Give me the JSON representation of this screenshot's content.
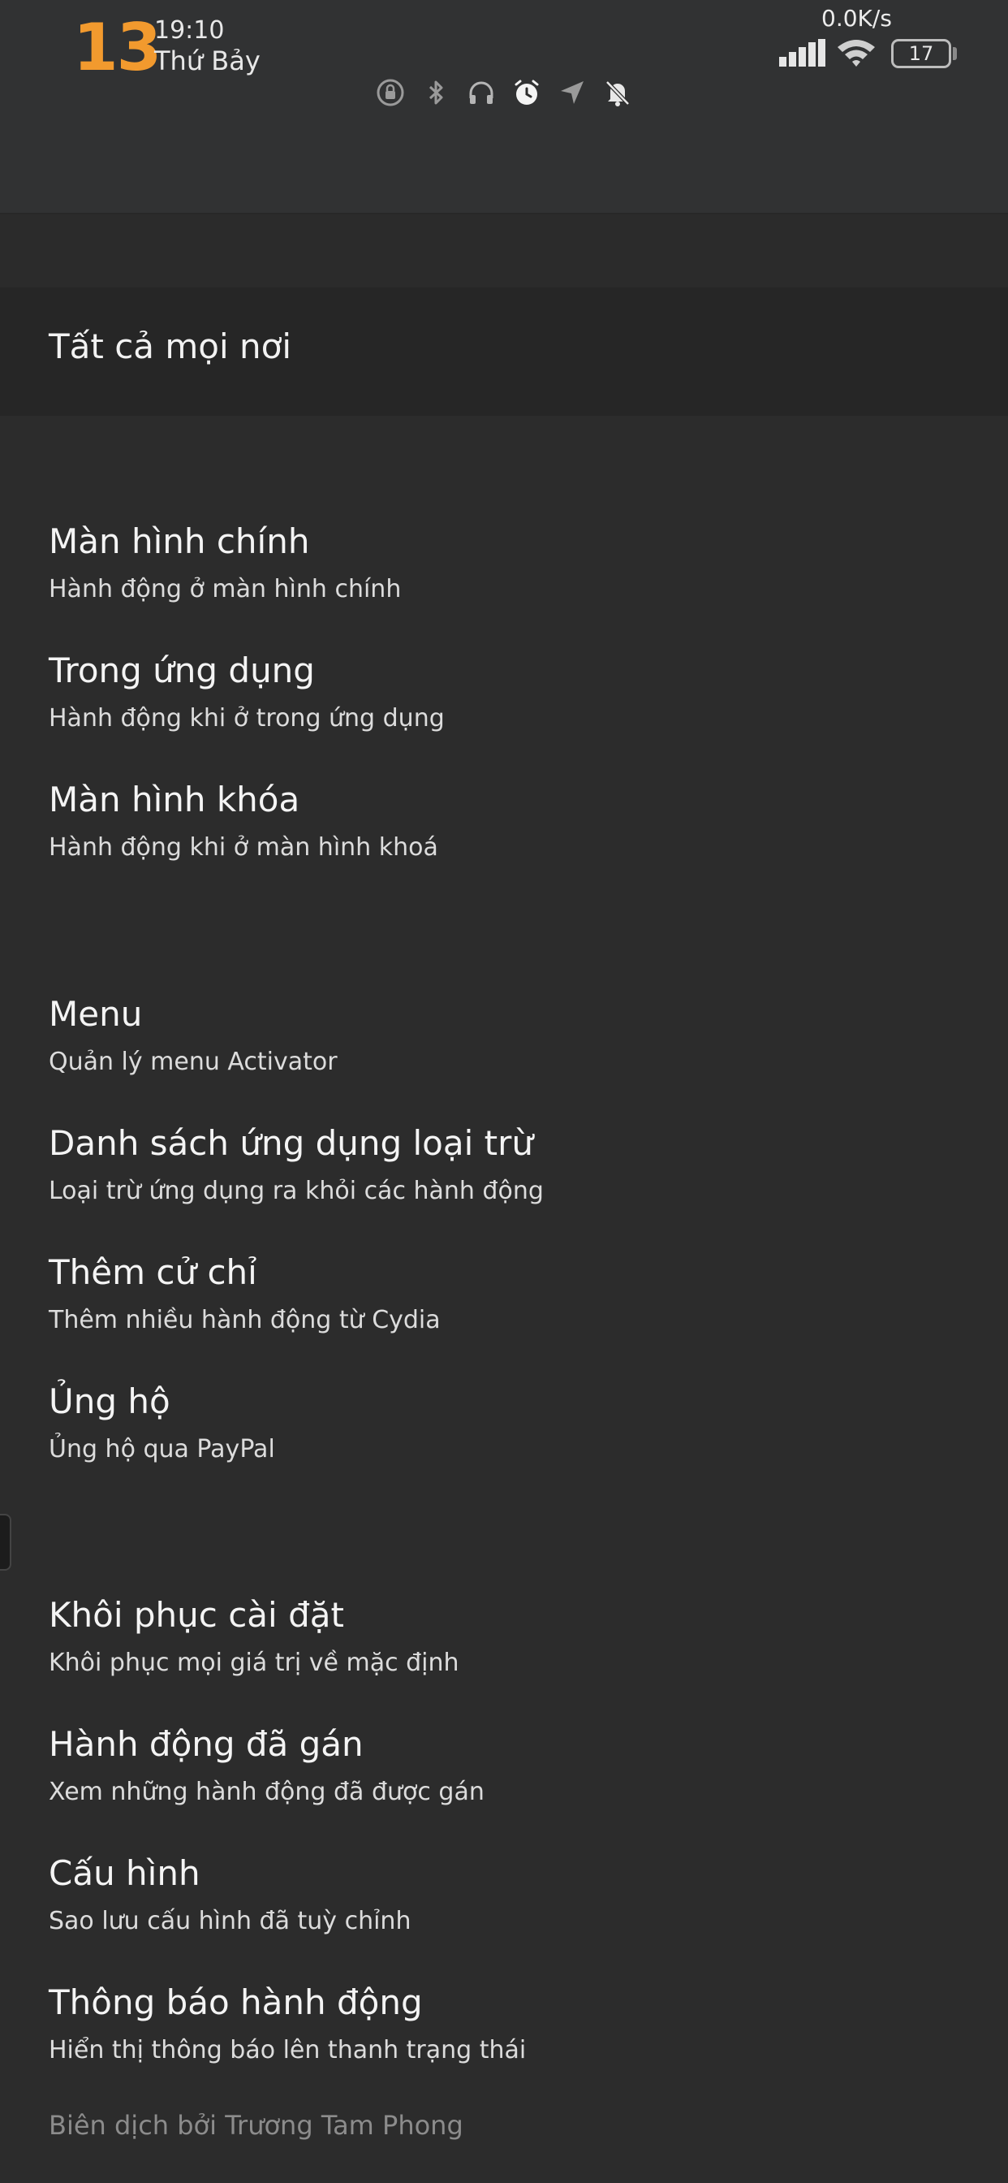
{
  "status_bar": {
    "day_number": "13",
    "time": "19:10",
    "weekday": "Thứ Bảy",
    "net_speed": "0.0K/s",
    "battery": "17",
    "icons": [
      "rotation-lock-icon",
      "bluetooth-icon",
      "headphones-icon",
      "alarm-icon",
      "location-icon",
      "silent-icon"
    ],
    "colors": {
      "accent": "#f29a2e",
      "background": "#2c2c2c",
      "banner": "#262626"
    }
  },
  "banner": {
    "label": "Tất cả mọi nơi"
  },
  "sections": [
    {
      "items": [
        {
          "title": "Màn hình chính",
          "subtitle": "Hành động ở màn hình chính"
        },
        {
          "title": "Trong ứng dụng",
          "subtitle": "Hành động khi ở trong ứng dụng"
        },
        {
          "title": "Màn hình khóa",
          "subtitle": "Hành động khi ở màn hình khoá"
        }
      ]
    },
    {
      "items": [
        {
          "title": "Menu",
          "subtitle": "Quản lý menu Activator"
        },
        {
          "title": "Danh sách ứng dụng loại trừ",
          "subtitle": "Loại trừ ứng dụng ra khỏi các hành động"
        },
        {
          "title": "Thêm cử chỉ",
          "subtitle": "Thêm nhiều hành động từ Cydia"
        },
        {
          "title": "Ủng hộ",
          "subtitle": "Ủng hộ qua PayPal"
        }
      ]
    },
    {
      "items": [
        {
          "title": "Khôi phục cài đặt",
          "subtitle": "Khôi phục mọi giá trị về mặc định"
        },
        {
          "title": "Hành động đã gán",
          "subtitle": "Xem những hành động đã được gán"
        },
        {
          "title": "Cấu hình",
          "subtitle": "Sao lưu cấu hình đã tuỳ chỉnh"
        },
        {
          "title": "Thông báo hành động",
          "subtitle": "Hiển thị thông báo lên thanh trạng thái"
        }
      ]
    }
  ],
  "footer": {
    "credit": "Biên dịch bởi Trương Tam Phong"
  }
}
